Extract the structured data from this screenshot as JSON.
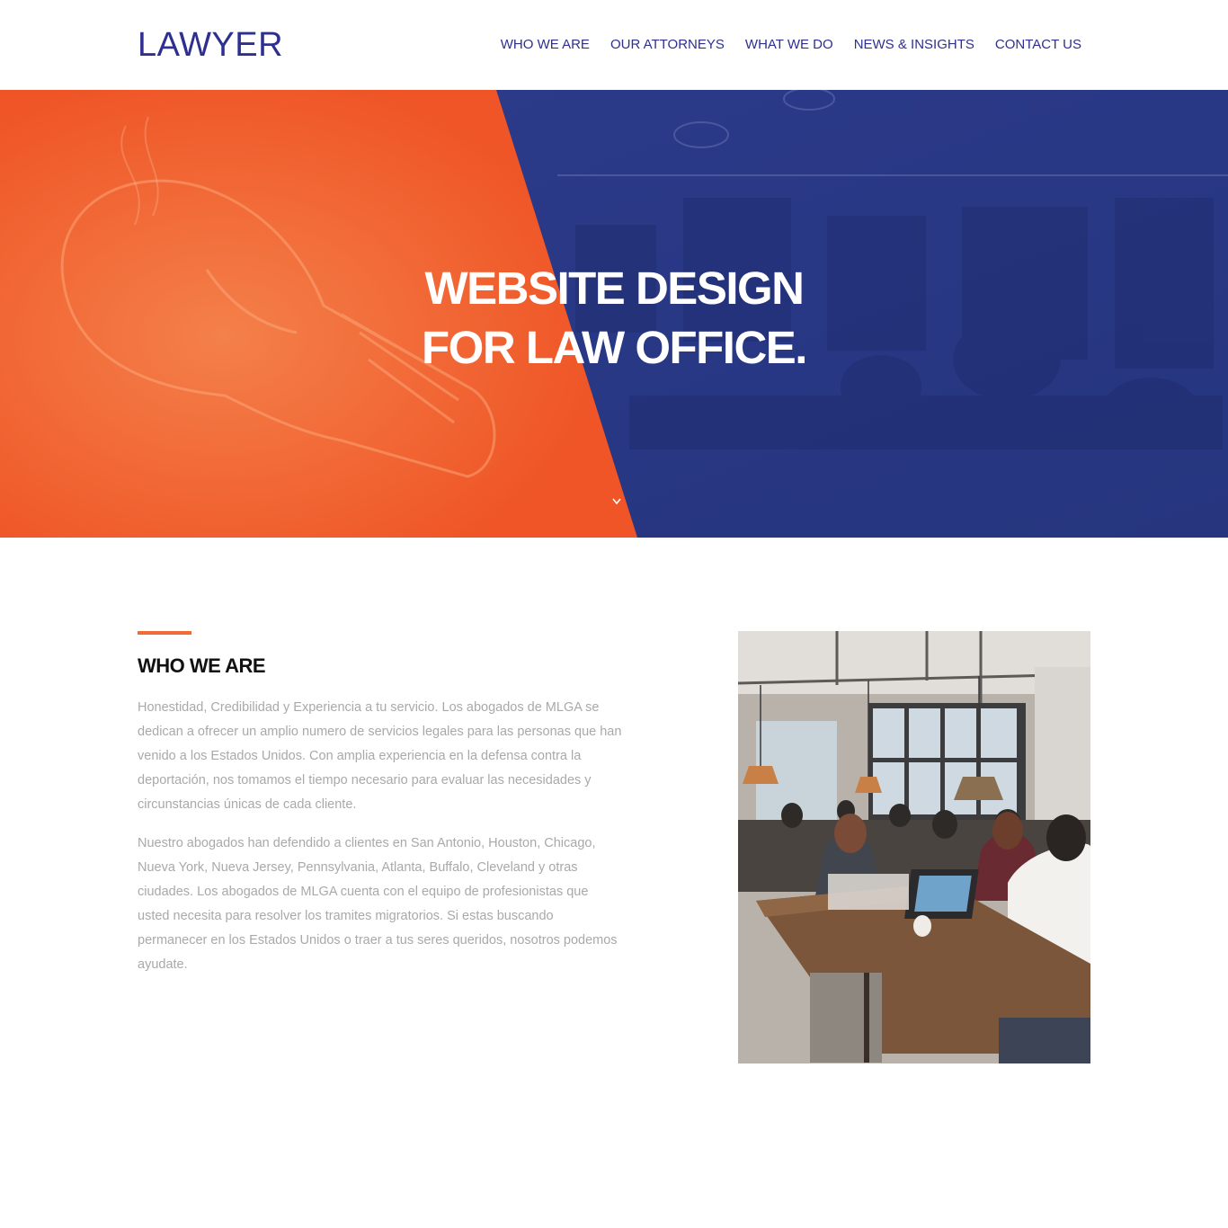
{
  "header": {
    "logo": "LAWYER",
    "nav": [
      {
        "label": "WHO WE ARE"
      },
      {
        "label": "OUR ATTORNEYS"
      },
      {
        "label": "WHAT WE DO"
      },
      {
        "label": "NEWS & INSIGHTS"
      },
      {
        "label": "CONTACT US"
      }
    ]
  },
  "hero": {
    "title_line1": "WEBSITE DESIGN",
    "title_line2": "FOR LAW OFFICE.",
    "scroll_icon": "chevron-down-icon",
    "left_color": "#f15a2b",
    "right_color": "#2a3986"
  },
  "about": {
    "title": "WHO WE ARE",
    "paragraph1": "Honestidad, Credibilidad y Experiencia a tu servicio. Los abogados de MLGA se dedican a ofrecer un amplio numero de servicios legales para las personas que han venido a los Estados Unidos. Con amplia experiencia en la defensa contra la deportación, nos tomamos el tiempo necesario para evaluar las necesidades y circunstancias únicas de cada cliente.",
    "paragraph2": "Nuestro abogados han defendido a clientes en San Antonio, Houston, Chicago, Nueva York, Nueva Jersey, Pennsylvania, Atlanta, Buffalo, Cleveland y otras ciudades. Los abogados de MLGA cuenta con el equipo de profesionistas que usted necesita para resolver los tramites migratorios. Si estas buscando permanecer en los Estados Unidos o traer a tus seres queridos, nosotros podemos ayudate.",
    "accent_color": "#f26a36"
  }
}
